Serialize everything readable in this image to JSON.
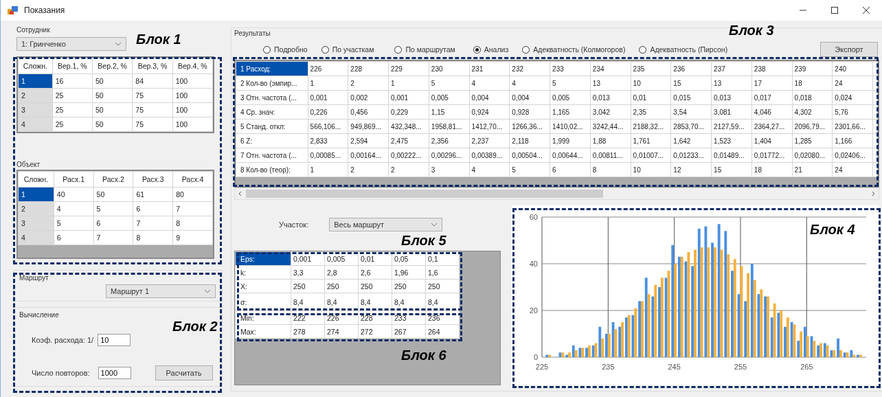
{
  "window": {
    "title": "Показания"
  },
  "employee": {
    "label": "Сотрудник",
    "value": "1: Гринченко"
  },
  "probability_table": {
    "columns": [
      "Сложн.",
      "Вер.1, %",
      "Вер.2, %",
      "Вер.3, %",
      "Вер.4, %"
    ],
    "rows": [
      {
        "cells": [
          "1",
          "16",
          "50",
          "84",
          "100"
        ],
        "selected": true
      },
      {
        "cells": [
          "2",
          "25",
          "50",
          "75",
          "100"
        ],
        "selected": false
      },
      {
        "cells": [
          "3",
          "25",
          "50",
          "75",
          "100"
        ],
        "selected": false
      },
      {
        "cells": [
          "4",
          "25",
          "50",
          "75",
          "100"
        ],
        "selected": false
      }
    ]
  },
  "object": {
    "label": "Объект",
    "columns": [
      "Сложн.",
      "Расх.1",
      "Расх.2",
      "Расх.3",
      "Расх.4"
    ],
    "rows": [
      {
        "cells": [
          "1",
          "40",
          "50",
          "61",
          "80"
        ],
        "selected": true
      },
      {
        "cells": [
          "2",
          "4",
          "5",
          "6",
          "7"
        ],
        "selected": false
      },
      {
        "cells": [
          "3",
          "5",
          "6",
          "7",
          "8"
        ],
        "selected": false
      },
      {
        "cells": [
          "4",
          "6",
          "7",
          "8",
          "9"
        ],
        "selected": false
      }
    ]
  },
  "route": {
    "label": "Маршрут",
    "value": "Маршрут 1"
  },
  "calculation": {
    "label": "Вычисление",
    "coefficient_label": "Коэф. расхода:  1/",
    "coefficient_value": "10",
    "repeats_label": "Число повторов:",
    "repeats_value": "1000",
    "button": "Расчитать"
  },
  "results": {
    "label": "Результаты",
    "modes": [
      {
        "label": "Подробно",
        "selected": false
      },
      {
        "label": "По участкам",
        "selected": false
      },
      {
        "label": "По маршрутам",
        "selected": false
      },
      {
        "label": "Анализ",
        "selected": true
      },
      {
        "label": "Адекватность  (Колмогоров)",
        "selected": false
      },
      {
        "label": "Адекватность  (Пирсон)",
        "selected": false
      }
    ],
    "export_button": "Экспорт",
    "table": {
      "rows": [
        {
          "header": "1 Расход:",
          "selected": true,
          "cells": [
            "226",
            "228",
            "229",
            "230",
            "231",
            "232",
            "233",
            "234",
            "235",
            "236",
            "237",
            "238",
            "239",
            "240"
          ]
        },
        {
          "header": "2 Кол-во (эмпир...",
          "selected": false,
          "cells": [
            "1",
            "2",
            "1",
            "5",
            "4",
            "4",
            "5",
            "13",
            "10",
            "15",
            "13",
            "17",
            "18",
            "24"
          ]
        },
        {
          "header": "3 Отн. частота (...",
          "selected": false,
          "cells": [
            "0,001",
            "0,002",
            "0,001",
            "0,005",
            "0,004",
            "0,004",
            "0,005",
            "0,013",
            "0,01",
            "0,015",
            "0,013",
            "0,017",
            "0,018",
            "0,024"
          ]
        },
        {
          "header": "4 Ср. знач:",
          "selected": false,
          "cells": [
            "0,226",
            "0,456",
            "0,229",
            "1,15",
            "0,924",
            "0,928",
            "1,165",
            "3,042",
            "2,35",
            "3,54",
            "3,081",
            "4,046",
            "4,302",
            "5,76"
          ]
        },
        {
          "header": "5 Станд. откл:",
          "selected": false,
          "cells": [
            "566,106...",
            "949,869...",
            "432,348...",
            "1958,81...",
            "1412,70...",
            "1266,36...",
            "1410,02...",
            "3242,44...",
            "2188,32...",
            "2853,70...",
            "2127,59...",
            "2364,27...",
            "2096,79...",
            "2301,66..."
          ]
        },
        {
          "header": "6 Z:",
          "selected": false,
          "cells": [
            "2,833",
            "2,594",
            "2,475",
            "2,356",
            "2,237",
            "2,118",
            "1,999",
            "1,88",
            "1,761",
            "1,642",
            "1,523",
            "1,404",
            "1,285",
            "1,166"
          ]
        },
        {
          "header": "7 Отн. частота (...",
          "selected": false,
          "cells": [
            "0,00085...",
            "0,00164...",
            "0,00222...",
            "0,00296...",
            "0,00389...",
            "0,00504...",
            "0,00644...",
            "0,00811...",
            "0,01007...",
            "0,01233...",
            "0,01489...",
            "0,01772...",
            "0,02080...",
            "0,02406..."
          ]
        },
        {
          "header": "8 Кол-во (теор):",
          "selected": false,
          "cells": [
            "1",
            "2",
            "2",
            "3",
            "4",
            "5",
            "6",
            "8",
            "10",
            "12",
            "15",
            "18",
            "21",
            "24"
          ]
        }
      ]
    },
    "section": {
      "label": "Участок:",
      "value": "Весь маршрут"
    },
    "stats_table": {
      "rows": [
        {
          "header": "Eps:",
          "selected": true,
          "cells": [
            "0,001",
            "0,005",
            "0,01",
            "0,05",
            "0,1"
          ]
        },
        {
          "header": "k:",
          "selected": false,
          "cells": [
            "3,3",
            "2,8",
            "2,6",
            "1,96",
            "1,6"
          ]
        },
        {
          "header": "X:",
          "selected": false,
          "cells": [
            "250",
            "250",
            "250",
            "250",
            "250"
          ]
        },
        {
          "header": "σ:",
          "selected": false,
          "cells": [
            "8,4",
            "8,4",
            "8,4",
            "8,4",
            "8,4"
          ]
        }
      ]
    },
    "range_table": {
      "rows": [
        {
          "header": "Min:",
          "selected": false,
          "cells": [
            "222",
            "226",
            "228",
            "233",
            "236"
          ]
        },
        {
          "header": "Max:",
          "selected": false,
          "cells": [
            "278",
            "274",
            "272",
            "267",
            "264"
          ]
        }
      ]
    },
    "chart_data": {
      "type": "bar",
      "x": [
        226,
        228,
        229,
        230,
        231,
        232,
        233,
        234,
        235,
        236,
        237,
        238,
        239,
        240,
        241,
        242,
        243,
        244,
        245,
        246,
        247,
        248,
        249,
        250,
        251,
        252,
        253,
        254,
        255,
        256,
        257,
        258,
        259,
        260,
        261,
        262,
        263,
        264,
        265,
        266,
        267,
        268,
        269,
        270,
        271,
        272,
        273
      ],
      "series": [
        {
          "color": "#4a8fe0",
          "values": [
            1,
            2,
            1,
            5,
            4,
            4,
            5,
            13,
            10,
            15,
            13,
            17,
            18,
            24,
            34,
            26,
            30,
            34,
            48,
            43,
            41,
            39,
            55,
            56,
            49,
            57,
            54,
            37,
            27,
            24,
            40,
            27,
            26,
            17,
            19,
            13,
            15,
            7,
            13,
            9,
            5,
            6,
            3,
            8,
            2,
            3,
            1
          ]
        },
        {
          "color": "#f5b13d",
          "values": [
            1,
            2,
            2,
            3,
            4,
            5,
            6,
            8,
            10,
            12,
            15,
            18,
            21,
            24,
            27,
            31,
            34,
            37,
            40,
            43,
            45,
            46,
            47,
            47,
            47,
            46,
            44,
            42,
            39,
            36,
            33,
            29,
            26,
            23,
            20,
            17,
            14,
            11,
            9,
            7,
            6,
            5,
            3,
            3,
            2,
            1,
            1
          ]
        }
      ],
      "grid": true,
      "xlim": [
        225,
        274
      ],
      "ylim": [
        0,
        60
      ],
      "xticks": [
        225,
        235,
        245,
        255,
        265
      ],
      "yticks": [
        0,
        20,
        40,
        60
      ]
    }
  },
  "annotations": [
    {
      "label": "Блок 1"
    },
    {
      "label": "Блок 2"
    },
    {
      "label": "Блок 3"
    },
    {
      "label": "Блок 4"
    },
    {
      "label": "Блок 5"
    },
    {
      "label": "Блок 6"
    }
  ]
}
